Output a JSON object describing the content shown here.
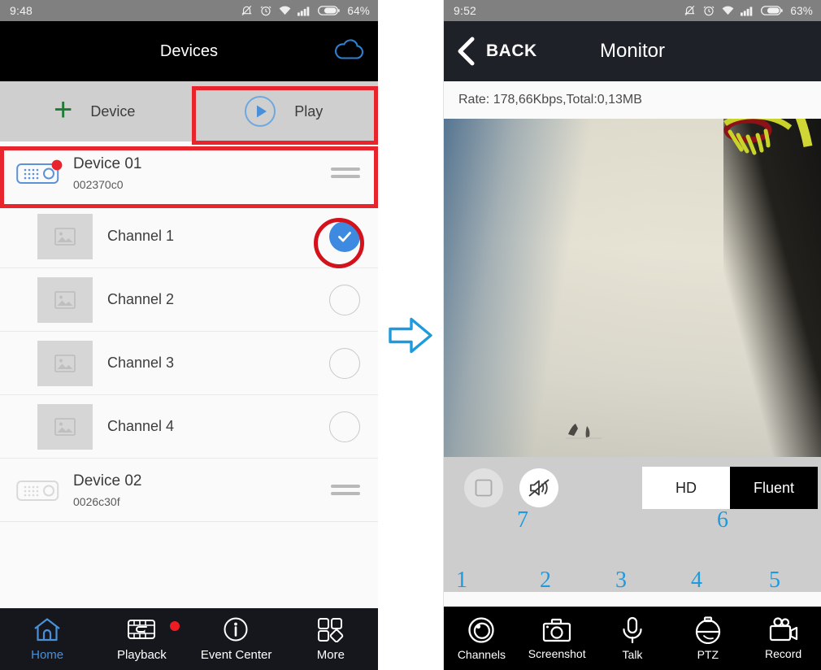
{
  "left": {
    "status": {
      "time": "9:48",
      "battery": "64%",
      "icons": [
        "bell-muted-icon",
        "alarm-clock-icon",
        "wifi-icon",
        "signal-bars-icon",
        "battery-icon"
      ]
    },
    "header": {
      "title": "Devices",
      "cloud_icon": "cloud-icon"
    },
    "actions": [
      {
        "label": "Device",
        "icon": "plus-icon"
      },
      {
        "label": "Play",
        "icon": "play-circle-icon",
        "highlighted": true
      }
    ],
    "devices": [
      {
        "name": "Device 01",
        "serial": "002370c0",
        "online": true,
        "highlighted": true,
        "channels": [
          {
            "label": "Channel 1",
            "selected": true
          },
          {
            "label": "Channel 2",
            "selected": false
          },
          {
            "label": "Channel 3",
            "selected": false
          },
          {
            "label": "Channel 4",
            "selected": false
          }
        ]
      },
      {
        "name": "Device 02",
        "serial": "0026c30f",
        "online": false,
        "highlighted": false,
        "channels": []
      }
    ],
    "bottom_nav": [
      {
        "label": "Home",
        "icon": "home-icon",
        "active": true,
        "badge": false
      },
      {
        "label": "Playback",
        "icon": "playback-icon",
        "active": false,
        "badge": false
      },
      {
        "label": "Event Center",
        "icon": "info-circle-icon",
        "active": false,
        "badge": true
      },
      {
        "label": "More",
        "icon": "grid-more-icon",
        "active": false,
        "badge": false
      }
    ]
  },
  "transition": {
    "icon": "right-arrow-icon",
    "color": "#1e9ade"
  },
  "right": {
    "status": {
      "time": "9:52",
      "battery": "63%"
    },
    "header": {
      "back_label": "BACK",
      "back_icon": "chevron-left-icon",
      "title": "Monitor"
    },
    "rate": "Rate: 178,66Kbps,Total:0,13MB",
    "video": {
      "description": "live camera view of a wall with basketball hoop"
    },
    "controls": {
      "stop": {
        "icon": "stop-square-icon"
      },
      "mute": {
        "icon": "speaker-muted-icon"
      },
      "quality": [
        {
          "label": "HD",
          "selected": false
        },
        {
          "label": "Fluent",
          "selected": true
        }
      ]
    },
    "toolbar": [
      {
        "label": "Channels",
        "icon": "channels-lens-icon"
      },
      {
        "label": "Screenshot",
        "icon": "camera-icon"
      },
      {
        "label": "Talk",
        "icon": "microphone-icon"
      },
      {
        "label": "PTZ",
        "icon": "ptz-dome-icon"
      },
      {
        "label": "Record",
        "icon": "video-camera-icon"
      }
    ],
    "annotations": [
      {
        "number": "1",
        "target": "Channels"
      },
      {
        "number": "2",
        "target": "Screenshot"
      },
      {
        "number": "3",
        "target": "Talk"
      },
      {
        "number": "4",
        "target": "PTZ"
      },
      {
        "number": "5",
        "target": "Record"
      },
      {
        "number": "6",
        "target": "quality-toggle"
      },
      {
        "number": "7",
        "target": "mute-button"
      }
    ]
  }
}
